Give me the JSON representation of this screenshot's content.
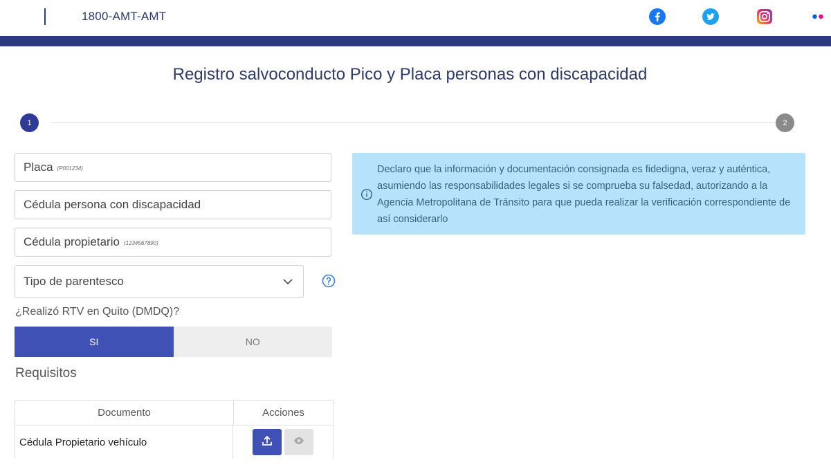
{
  "header": {
    "phone": "1800-AMT-AMT",
    "social": [
      "facebook-icon",
      "twitter-icon",
      "instagram-icon",
      "flickr-icon"
    ],
    "brand_color": "#2d3a80"
  },
  "page": {
    "title": "Registro salvoconducto Pico y Placa personas con discapacidad"
  },
  "stepper": {
    "steps": [
      "1",
      "2"
    ],
    "active_step": 1,
    "active_color": "#2d3a96",
    "inactive_color": "#8a8a8a"
  },
  "form": {
    "placa": {
      "label": "Placa",
      "hint": "(P001234)"
    },
    "cedula_discapacidad": {
      "label": "Cédula persona con discapacidad"
    },
    "cedula_propietario": {
      "label": "Cédula propietario",
      "hint": "(1234567890)"
    },
    "parentesco": {
      "label": "Tipo de parentesco",
      "selected": ""
    },
    "rtv_question": "¿Realizó RTV en Quito (DMDQ)?",
    "rtv_options": {
      "yes": "SI",
      "no": "NO",
      "selected": "SI"
    }
  },
  "requirements": {
    "title": "Requisitos",
    "columns": [
      "Documento",
      "Acciones"
    ],
    "rows": [
      {
        "document": "Cédula Propietario vehículo",
        "actions": [
          "upload-icon",
          "eye-icon"
        ]
      }
    ]
  },
  "notice": {
    "icon": "info-icon",
    "text": "Declaro que la información y documentación consignada es fidedigna, veraz y auténtica, asumiendo las responsabilidades legales si se comprueba su falsedad, autorizando a la Agencia Metropolitana de Tránsito para que pueda realizar la verificación correspondiente de así considerarlo",
    "background": "#b6e3fb"
  }
}
